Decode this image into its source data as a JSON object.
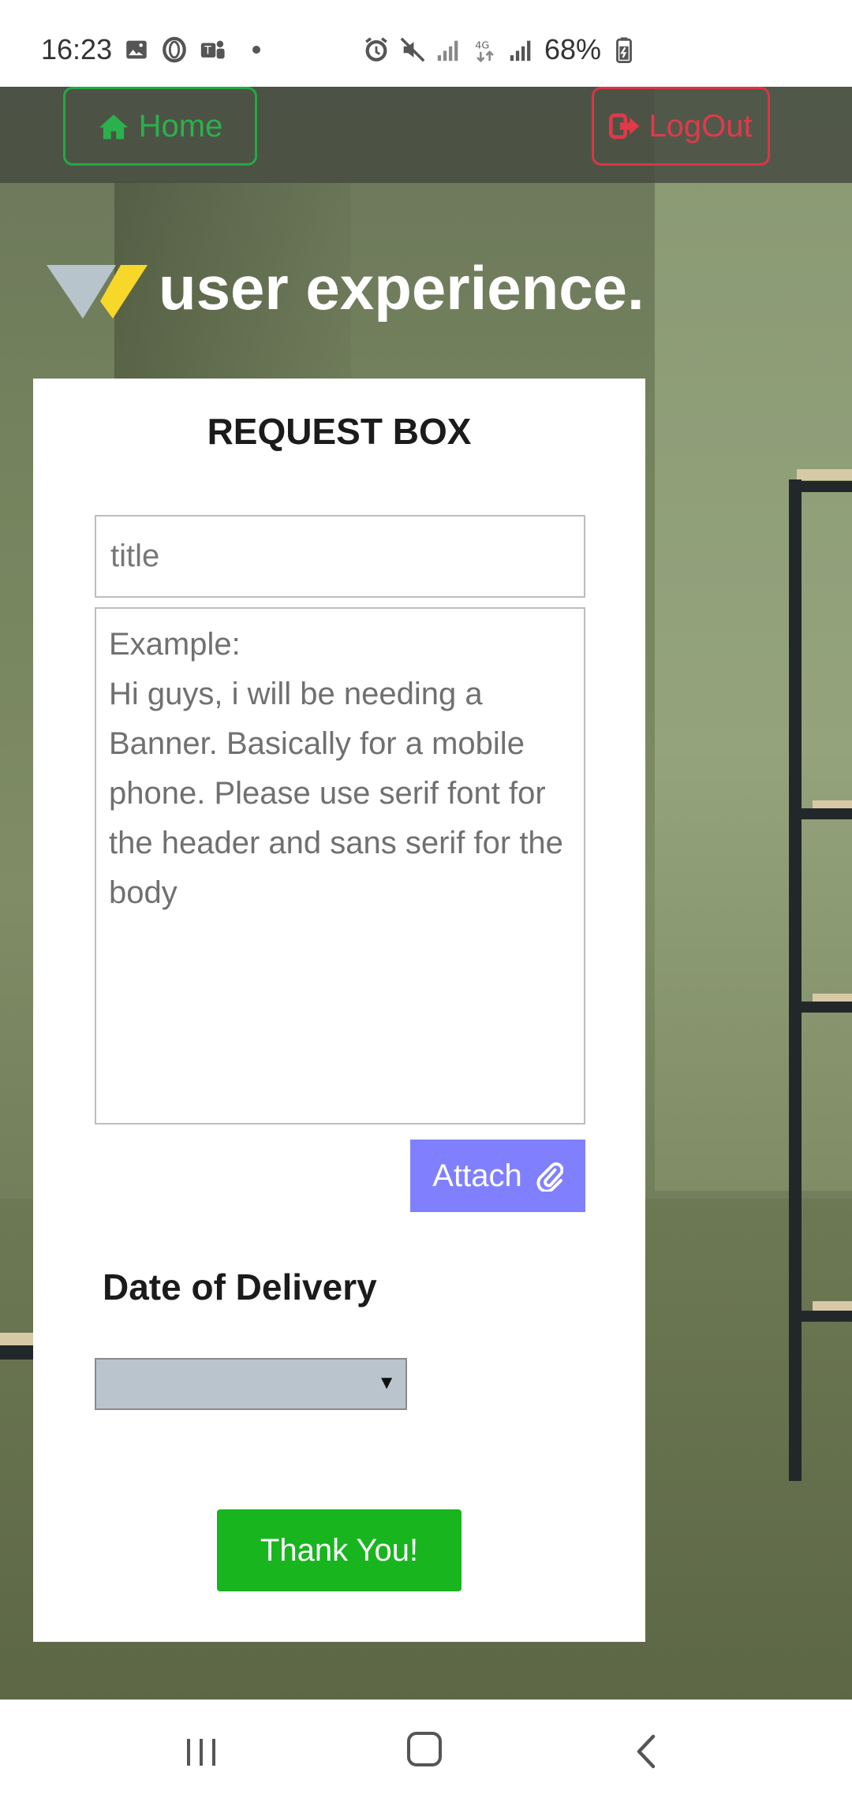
{
  "status_bar": {
    "time": "16:23",
    "battery": "68%",
    "network": "4G",
    "icons_left": [
      "gallery-icon",
      "opera-icon",
      "teams-icon",
      "dot-icon"
    ],
    "icons_right": [
      "alarm-icon",
      "mute-icon",
      "signal-icon",
      "network-4g-icon",
      "signal-icon",
      "battery-icon"
    ]
  },
  "nav": {
    "home_label": "Home",
    "logout_label": "LogOut",
    "home_color": "#2ab14c",
    "logout_color": "#e0394a"
  },
  "brand": {
    "text": "user experience."
  },
  "request_box": {
    "title": "REQUEST BOX",
    "title_placeholder": "title",
    "description_placeholder": "Example:\nHi guys, i will be needing a Banner. Basically for a mobile phone. Please use serif font for the header and sans serif for the body",
    "attach_label": "Attach",
    "attach_color": "#8080ff",
    "delivery_label": "Date of Delivery",
    "delivery_selected": "",
    "submit_label": "Thank You!",
    "submit_color": "#18b51f"
  },
  "system_nav": {
    "buttons": [
      "recent-apps",
      "home",
      "back"
    ]
  }
}
